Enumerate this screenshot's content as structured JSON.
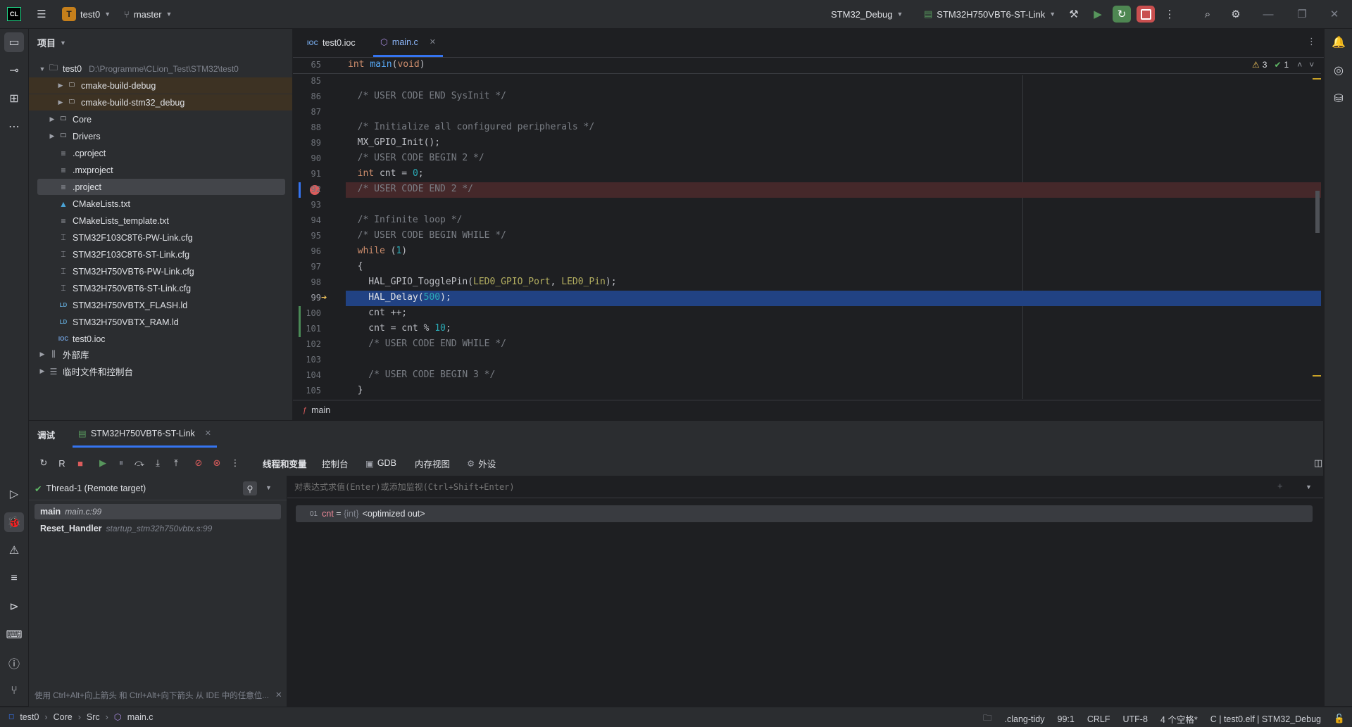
{
  "titlebar": {
    "project_badge": "T",
    "project_name": "test0",
    "branch": "master",
    "run_config": "STM32_Debug",
    "debug_target": "STM32H750VBT6-ST-Link",
    "icons": [
      "app-logo-icon",
      "hamburger-menu-icon",
      "branch-icon",
      "build-icon",
      "resume-icon",
      "debug-rerun-icon",
      "stop-icon",
      "more-icon",
      "search-icon",
      "settings-icon",
      "minimize-icon",
      "maximize-icon",
      "close-icon"
    ]
  },
  "project": {
    "title": "项目",
    "root_name": "test0",
    "root_path": "D:\\Programme\\CLion_Test\\STM32\\test0",
    "items": [
      {
        "label": "cmake-build-debug",
        "type": "folder",
        "expandable": true,
        "excluded": true
      },
      {
        "label": "cmake-build-stm32_debug",
        "type": "folder",
        "expandable": true,
        "excluded": true
      },
      {
        "label": "Core",
        "type": "folder",
        "expandable": true
      },
      {
        "label": "Drivers",
        "type": "folder",
        "expandable": true
      },
      {
        "label": ".cproject",
        "type": "text"
      },
      {
        "label": ".mxproject",
        "type": "text"
      },
      {
        "label": ".project",
        "type": "text",
        "selected": true
      },
      {
        "label": "CMakeLists.txt",
        "type": "cmake"
      },
      {
        "label": "CMakeLists_template.txt",
        "type": "text"
      },
      {
        "label": "STM32F103C8T6-PW-Link.cfg",
        "type": "cfg"
      },
      {
        "label": "STM32F103C8T6-ST-Link.cfg",
        "type": "cfg"
      },
      {
        "label": "STM32H750VBT6-PW-Link.cfg",
        "type": "cfg"
      },
      {
        "label": "STM32H750VBT6-ST-Link.cfg",
        "type": "cfg"
      },
      {
        "label": "STM32H750VBTX_FLASH.ld",
        "type": "ld"
      },
      {
        "label": "STM32H750VBTX_RAM.ld",
        "type": "ld"
      },
      {
        "label": "test0.ioc",
        "type": "ioc"
      }
    ],
    "external_libs": "外部库",
    "scratches": "临时文件和控制台"
  },
  "editor": {
    "tabs": [
      {
        "label": "test0.ioc",
        "icon": "ioc-icon"
      },
      {
        "label": "main.c",
        "icon": "c-file-icon",
        "active": true
      }
    ],
    "sticky_line_no": "65",
    "sticky_code": "int main(void)",
    "warnings": "3",
    "ok_count": "1",
    "lines": [
      {
        "no": "85",
        "code": ""
      },
      {
        "no": "86",
        "code": "  /* USER CODE END SysInit */"
      },
      {
        "no": "87",
        "code": ""
      },
      {
        "no": "88",
        "code": "  /* Initialize all configured peripherals */"
      },
      {
        "no": "89",
        "code": "  MX_GPIO_Init();"
      },
      {
        "no": "90",
        "code": "  /* USER CODE BEGIN 2 */"
      },
      {
        "no": "91",
        "code": "  int cnt = 0;"
      },
      {
        "no": "92",
        "code": "  /* USER CODE END 2 */"
      },
      {
        "no": "93",
        "code": ""
      },
      {
        "no": "94",
        "code": "  /* Infinite loop */"
      },
      {
        "no": "95",
        "code": "  /* USER CODE BEGIN WHILE */"
      },
      {
        "no": "96",
        "code": "  while (1)"
      },
      {
        "no": "97",
        "code": "  {"
      },
      {
        "no": "98",
        "code": "    HAL_GPIO_TogglePin(LED0_GPIO_Port, LED0_Pin);"
      },
      {
        "no": "99",
        "code": "    HAL_Delay(500);"
      },
      {
        "no": "100",
        "code": "    cnt ++;"
      },
      {
        "no": "101",
        "code": "    cnt = cnt % 10;"
      },
      {
        "no": "102",
        "code": "    /* USER CODE END WHILE */"
      },
      {
        "no": "103",
        "code": ""
      },
      {
        "no": "104",
        "code": "    /* USER CODE BEGIN 3 */"
      },
      {
        "no": "105",
        "code": "  }"
      }
    ],
    "breadcrumb_func": "main"
  },
  "debug": {
    "tab_label": "调试",
    "session_label": "STM32H750VBT6-ST-Link",
    "subtabs": [
      "线程和变量",
      "控制台",
      "GDB",
      "内存视图",
      "外设"
    ],
    "thread": "Thread-1 (Remote target)",
    "frames": [
      {
        "name": "main",
        "loc": "main.c:99",
        "selected": true
      },
      {
        "name": "Reset_Handler",
        "loc": "startup_stm32h750vbtx.s:99"
      }
    ],
    "eval_placeholder": "对表达式求值(Enter)或添加监视(Ctrl+Shift+Enter)",
    "variable": {
      "name": "cnt",
      "eq": " = ",
      "type": "{int}",
      "value": "<optimized out>"
    },
    "hint": "使用 Ctrl+Alt+向上箭头 和 Ctrl+Alt+向下箭头 从 IDE 中的任意位..."
  },
  "statusbar": {
    "crumbs": [
      "test0",
      "Core",
      "Src",
      "main.c"
    ],
    "linter": ".clang-tidy",
    "position": "99:1",
    "line_sep": "CRLF",
    "encoding": "UTF-8",
    "indent": "4 个空格*",
    "context": "C | test0.elf | STM32_Debug"
  }
}
